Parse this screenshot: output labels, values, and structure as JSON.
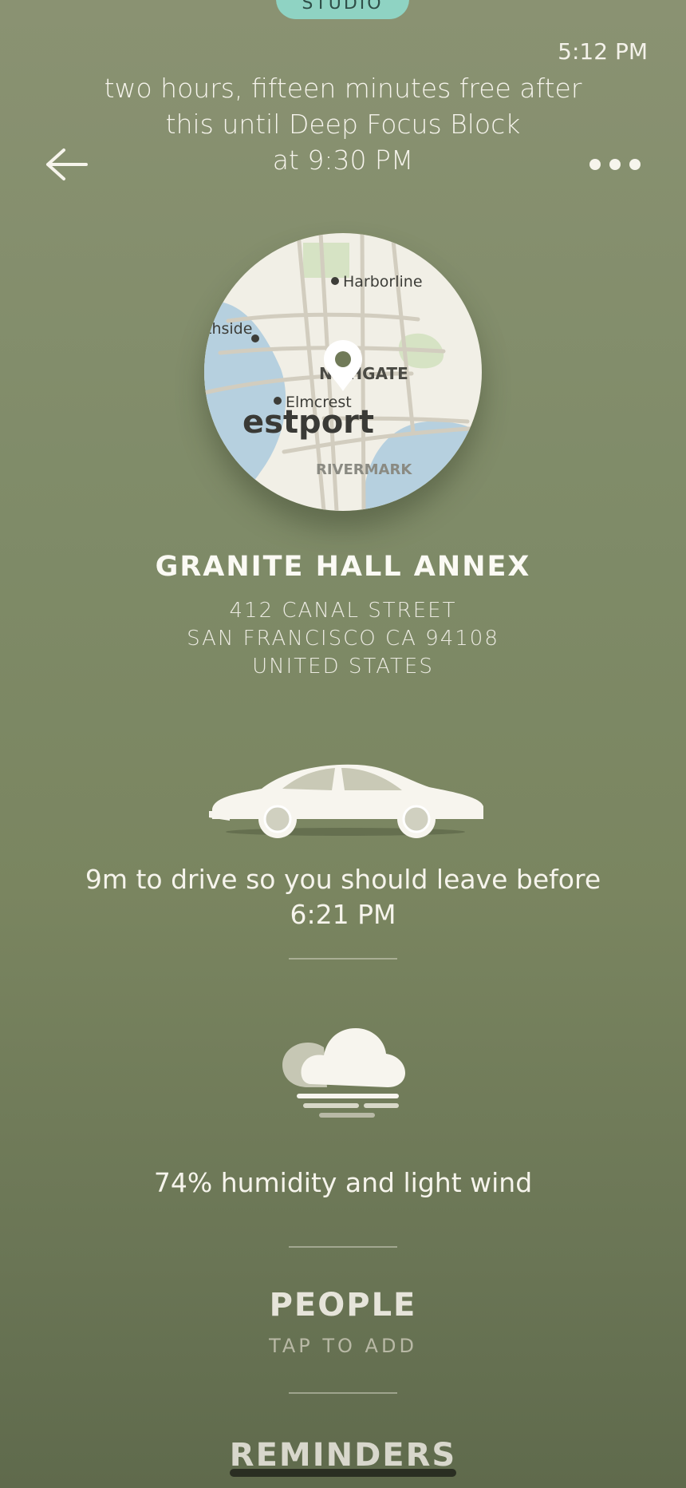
{
  "header": {
    "tag_label": "STUDIO",
    "time": "5:12 PM",
    "free_time_line1": "two hours, fifteen minutes free after",
    "free_time_line2": "this until Deep Focus Block",
    "free_time_line3": "at 9:30 PM"
  },
  "map": {
    "labels": {
      "harborline": "Harborline",
      "northside": "thside",
      "northgate": "N     THGATE",
      "elmcrest": "Elmcrest",
      "westport": "estport",
      "rivermark": "RIVERMARK"
    },
    "water_color": "#b6d0df",
    "land_color": "#f1efe6",
    "park_color": "#d6e3c4"
  },
  "location": {
    "name": "GRANITE HALL ANNEX",
    "street": "412 CANAL STREET",
    "city": "SAN FRANCISCO CA 94108",
    "country": "UNITED STATES"
  },
  "travel": {
    "line1": "9m to drive so you should leave before",
    "line2": "6:21 PM"
  },
  "weather": {
    "description": "74% humidity and light wind"
  },
  "people": {
    "title": "PEOPLE",
    "subtitle": "TAP TO ADD"
  },
  "reminders": {
    "title": "REMINDERS"
  },
  "icons": {
    "back": "arrow-left-icon",
    "more": "more-horizontal-icon",
    "car": "car-icon",
    "weather": "cloud-fog-icon",
    "pin": "map-pin-icon"
  }
}
